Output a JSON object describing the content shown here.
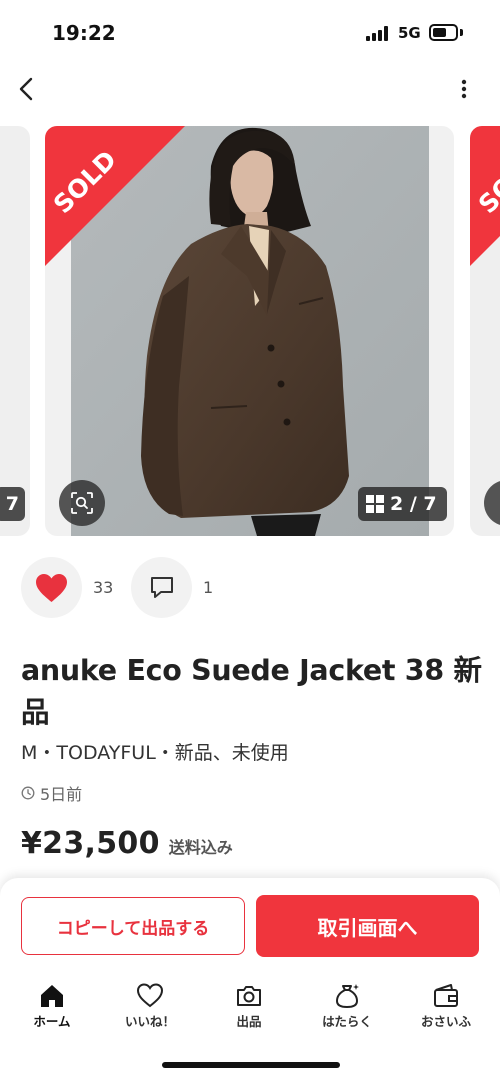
{
  "status_bar": {
    "time": "19:22",
    "network": "5G"
  },
  "header": {
    "back_icon": "chevron-left-icon",
    "menu_icon": "more-vertical-icon"
  },
  "carousel": {
    "sold_label": "SOLD",
    "page_indicator": "2 / 7",
    "prev_page_fragment": "7",
    "sold_color": "#f0353d"
  },
  "social": {
    "like_count": "33",
    "comment_count": "1",
    "like_color": "#e8323e"
  },
  "product": {
    "title": "anuke Eco Suede Jacket 38 新品",
    "meta": "M・TODAYFUL・新品、未使用",
    "posted": "5日前",
    "price": "¥23,500",
    "shipping": "送料込み"
  },
  "actions": {
    "copy_label": "コピーして出品する",
    "trade_label": "取引画面へ",
    "accent_color": "#f0353d"
  },
  "tab_bar": {
    "items": [
      {
        "label": "ホーム",
        "icon": "home-icon"
      },
      {
        "label": "いいね！",
        "icon": "heart-outline-icon"
      },
      {
        "label": "出品",
        "icon": "camera-icon"
      },
      {
        "label": "はたらく",
        "icon": "money-bag-icon"
      },
      {
        "label": "おさいふ",
        "icon": "wallet-icon"
      }
    ]
  }
}
